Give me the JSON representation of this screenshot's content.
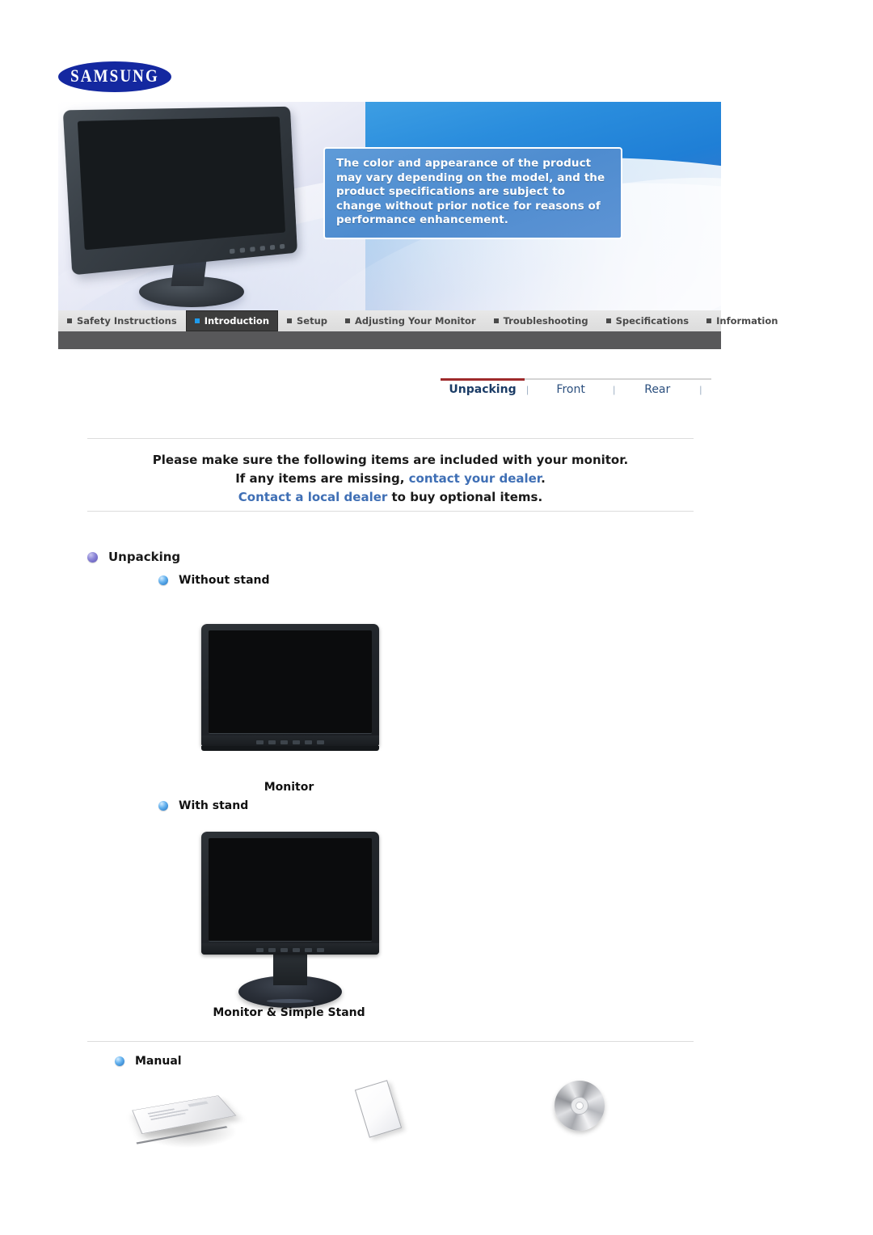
{
  "brand": {
    "name": "SAMSUNG"
  },
  "hero": {
    "callout": "The color and appearance of the product may vary depending on the model, and the product specifications are subject to change without prior notice for reasons of performance enhancement.",
    "monitor_alt": "monitor-product-image"
  },
  "nav": {
    "tabs": [
      {
        "label": "Safety Instructions",
        "active": false
      },
      {
        "label": "Introduction",
        "active": true
      },
      {
        "label": "Setup",
        "active": false
      },
      {
        "label": "Adjusting Your Monitor",
        "active": false
      },
      {
        "label": "Troubleshooting",
        "active": false
      },
      {
        "label": "Specifications",
        "active": false
      },
      {
        "label": "Information",
        "active": false
      }
    ]
  },
  "subnav": {
    "items": [
      {
        "label": "Unpacking",
        "active": true
      },
      {
        "label": "Front",
        "active": false
      },
      {
        "label": "Rear",
        "active": false
      }
    ],
    "separator": "|",
    "active_color": "#9e2a2b",
    "link_color": "#2b4f7e"
  },
  "intro": {
    "line1": "Please make sure the following items are included with your monitor.",
    "line2_prefix": "If any items are missing, ",
    "line2_link": "contact your dealer",
    "line2_suffix": ".",
    "line3_link": "Contact a local dealer",
    "line3_suffix": " to buy optional items.",
    "link_color": "#3f6fb5"
  },
  "sections": {
    "unpacking": {
      "label": "Unpacking",
      "bullet": "bullet-purple-icon"
    },
    "without_stand": {
      "label": "Without stand",
      "bullet": "bullet-blue-icon"
    },
    "with_stand": {
      "label": "With stand",
      "bullet": "bullet-blue-icon"
    },
    "manual": {
      "label": "Manual",
      "bullet": "bullet-blue-icon"
    }
  },
  "captions": {
    "monitor": "Monitor",
    "monitor_simple_stand": "Monitor & Simple Stand"
  },
  "accessories": [
    {
      "name": "manual-book-icon"
    },
    {
      "name": "warranty-card-icon"
    },
    {
      "name": "cd-disc-icon"
    }
  ]
}
